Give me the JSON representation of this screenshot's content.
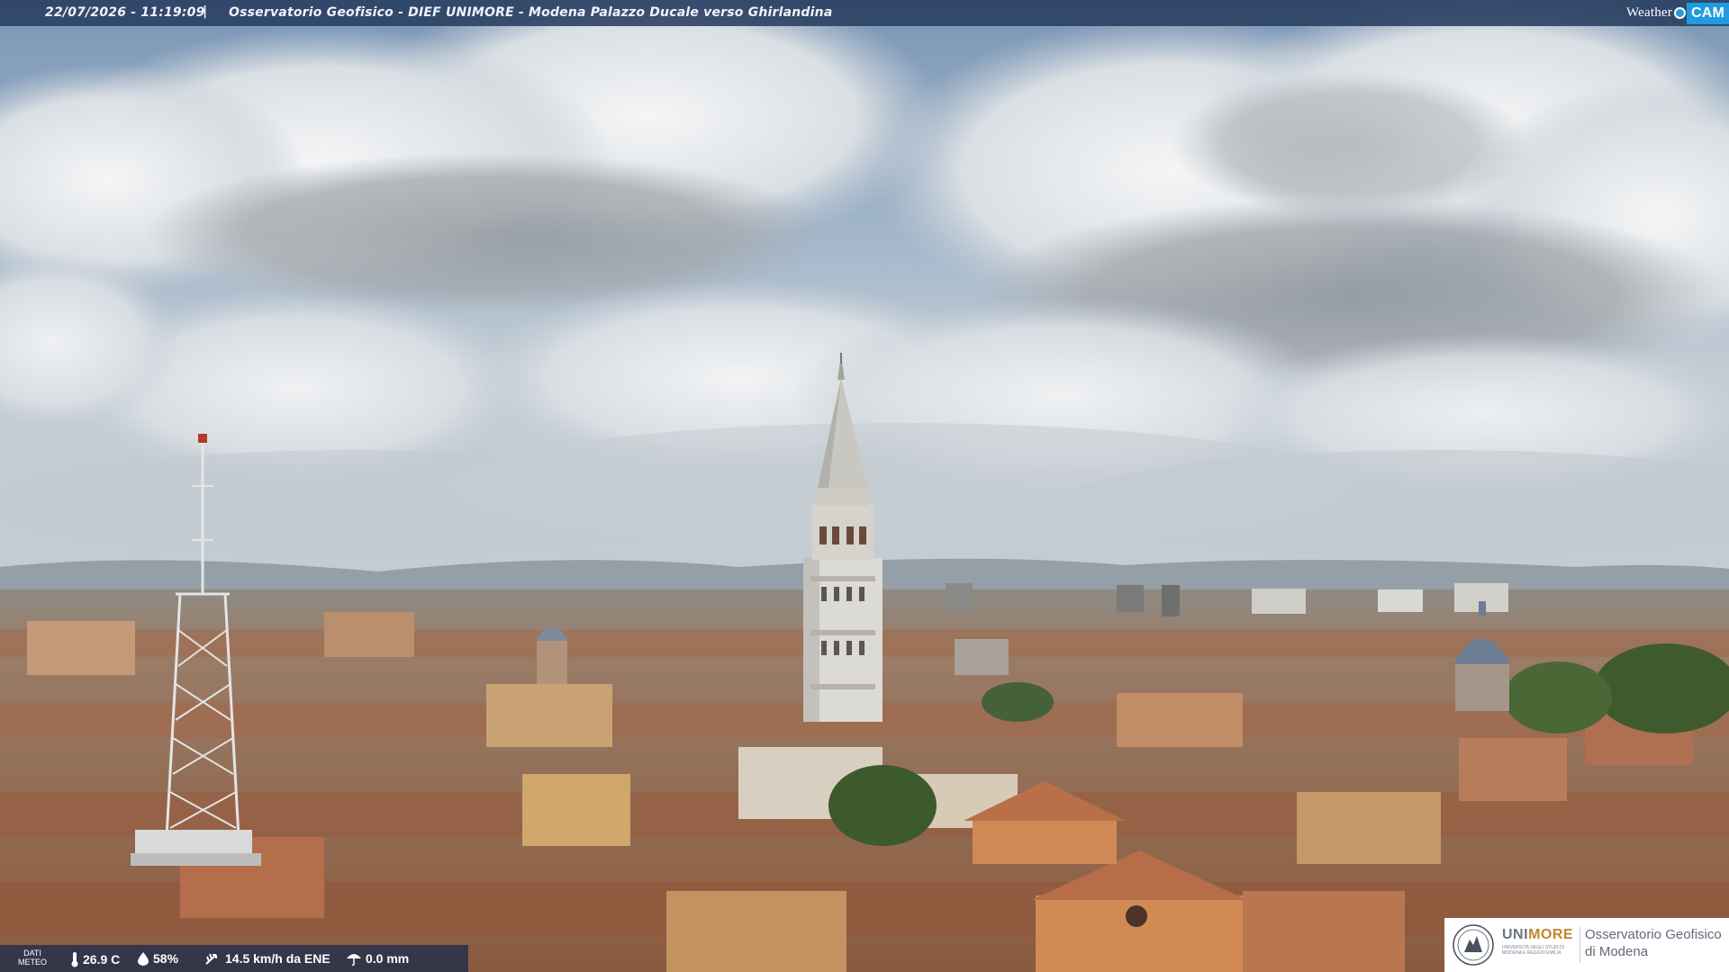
{
  "topbar": {
    "datetime": "22/07/2026 - 11:19:09",
    "separator": "|",
    "title": "Osservatorio Geofisico - DIEF UNIMORE - Modena Palazzo Ducale verso Ghirlandina",
    "brand_weather": "Weather",
    "brand_cam": "CAM"
  },
  "meteo": {
    "label_line1": "DATI",
    "label_line2": "METEO",
    "temperature": "26.9 C",
    "humidity": "58%",
    "wind": "14.5 km/h da ENE",
    "rain": "0.0 mm"
  },
  "logo": {
    "uni_part1": "UNI",
    "uni_part2": "MORE",
    "uni_small": "UNIVERSITÀ DEGLI STUDI DI MODENA E REGGIO EMILIA",
    "obs_line1": "Osservatorio Geofisico",
    "obs_line2": "di Modena"
  },
  "colors": {
    "sky_top": "#7f9ab8",
    "cloud": "#e9ecef",
    "roof": "#b8754f",
    "tower": "#d9d7d2",
    "bar": "#283e60",
    "accent": "#1f9be0"
  }
}
